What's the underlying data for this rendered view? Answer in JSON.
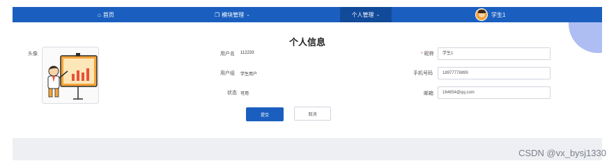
{
  "nav": {
    "home_label": "首页",
    "modules_label": "模块管理",
    "personal_label": "个人管理",
    "username": "学生1"
  },
  "page_title": "个人信息",
  "avatar_label": "头像",
  "fields": {
    "username_label": "用户名",
    "username_value": "112233",
    "group_label": "用户组",
    "group_value": "学生用户",
    "status_label": "状态",
    "status_value": "可用",
    "nickname_label": "昵称",
    "nickname_value": "学生1",
    "phone_label": "手机号码",
    "phone_value": "18977778899",
    "email_label": "邮箱",
    "email_value": "164654@qq.com"
  },
  "buttons": {
    "submit": "提交",
    "cancel": "取消"
  },
  "watermark": "CSDN @vx_bysj1330",
  "colors": {
    "navbar": "#1a5fbf",
    "nav_active": "#124a9a",
    "accent_circle": "#aebef3"
  }
}
